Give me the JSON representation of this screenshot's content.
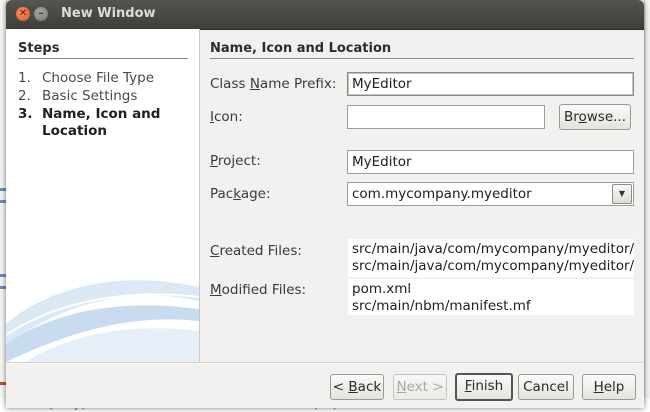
{
  "window": {
    "title": "New Window"
  },
  "steps": {
    "heading": "Steps",
    "items": [
      {
        "num": "1.",
        "label": "Choose File Type"
      },
      {
        "num": "2.",
        "label": "Basic Settings"
      },
      {
        "num": "3.",
        "label": "Name, Icon and Location"
      }
    ],
    "current_index": 2
  },
  "form": {
    "heading": "Name, Icon and Location",
    "class_name_prefix": {
      "label_pre": "Class ",
      "label_key": "N",
      "label_post": "ame Prefix:",
      "value": "MyEditor"
    },
    "icon": {
      "label_pre": "",
      "label_key": "I",
      "label_post": "con:",
      "value": ""
    },
    "browse_button": {
      "label_pre": "Br",
      "label_key": "o",
      "label_post": "wse..."
    },
    "project": {
      "label_pre": "",
      "label_key": "P",
      "label_post": "roject:",
      "value": "MyEditor"
    },
    "package": {
      "label_pre": "Pac",
      "label_key": "k",
      "label_post": "age:",
      "value": "com.mycompany.myeditor",
      "arrow": "▼"
    },
    "created_files": {
      "label_pre": "",
      "label_key": "C",
      "label_post": "reated Files:",
      "lines": [
        "src/main/java/com/mycompany/myeditor/MyEditor",
        "src/main/java/com/mycompany/myeditor/MyEditor"
      ]
    },
    "modified_files": {
      "label_pre": "",
      "label_key": "M",
      "label_post": "odified Files:",
      "lines": [
        "pom.xml",
        "src/main/nbm/manifest.mf"
      ]
    }
  },
  "footer": {
    "back": {
      "pre": "< ",
      "key": "B",
      "post": "ack"
    },
    "next": {
      "pre": "",
      "key": "N",
      "post": "ext >"
    },
    "finish": {
      "pre": "",
      "key": "F",
      "post": "inish"
    },
    "cancel": "Cancel",
    "help": {
      "pre": "",
      "key": "H",
      "post": "elp"
    }
  },
  "background": {
    "bottom_text": "T....(ally) Set.ur..l.u...Jdua.a..ut.D...t...(..)"
  },
  "colors": {
    "titlebar": "#3e3e3b",
    "close_button": "#e0541c",
    "dialog_bg": "#f2f1f0",
    "wave_blue": "#c9dcef"
  }
}
